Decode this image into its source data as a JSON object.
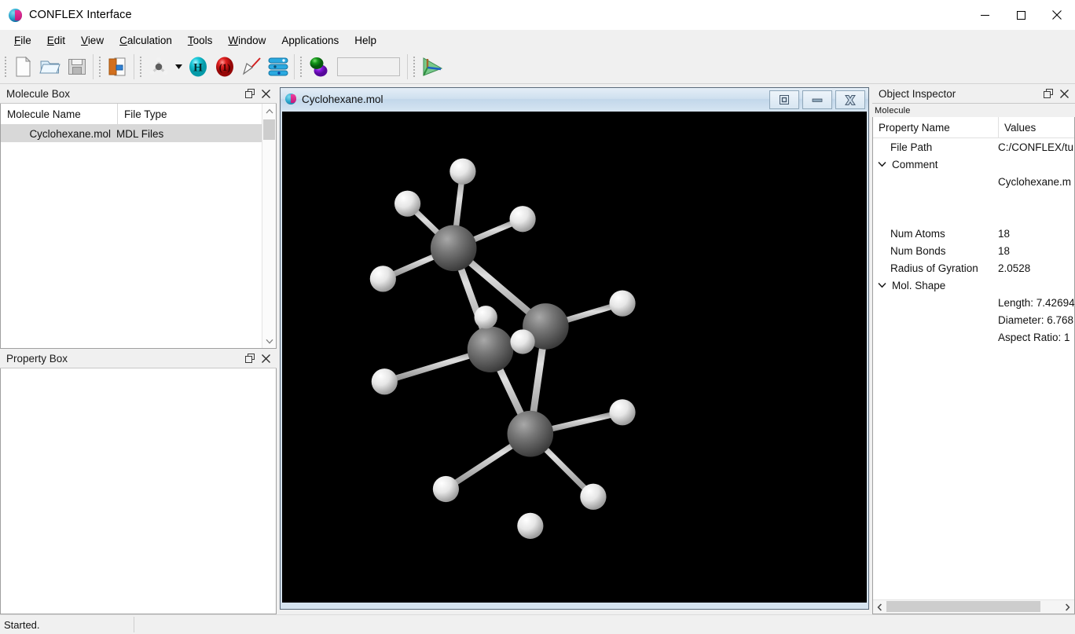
{
  "window": {
    "title": "CONFLEX Interface",
    "logo_icon": "conflex-logo-icon",
    "controls": [
      {
        "name": "minimize",
        "icon": "minimize-icon"
      },
      {
        "name": "maximize",
        "icon": "maximize-icon"
      },
      {
        "name": "close",
        "icon": "close-icon"
      }
    ]
  },
  "menubar": {
    "items": [
      {
        "label": "File",
        "mnemonic": "F"
      },
      {
        "label": "Edit",
        "mnemonic": "E"
      },
      {
        "label": "View",
        "mnemonic": "V"
      },
      {
        "label": "Calculation",
        "mnemonic": "C"
      },
      {
        "label": "Tools",
        "mnemonic": "T"
      },
      {
        "label": "Window",
        "mnemonic": "W"
      },
      {
        "label": "Applications",
        "mnemonic": ""
      },
      {
        "label": "Help",
        "mnemonic": ""
      }
    ]
  },
  "toolbar": {
    "buttons": [
      {
        "name": "new-file-button",
        "icon": "new-document-icon"
      },
      {
        "name": "open-file-button",
        "icon": "open-folder-icon"
      },
      {
        "name": "save-file-button",
        "icon": "floppy-save-icon"
      },
      {
        "name": "import-export-button",
        "icon": "import-document-icon"
      },
      {
        "name": "molecule-model-button",
        "icon": "molecule-model-icon"
      },
      {
        "name": "molecule-model-dropdown",
        "icon": "chevron-down-icon"
      },
      {
        "name": "add-hydrogen-button",
        "icon": "hydrogen-sphere-icon",
        "label": "H"
      },
      {
        "name": "formal-charge-button",
        "icon": "charge-sphere-icon",
        "label": "(1)"
      },
      {
        "name": "draw-tool-button",
        "icon": "pencil-wand-icon"
      },
      {
        "name": "layers-button",
        "icon": "stacked-layers-icon"
      },
      {
        "name": "optimize-button",
        "icon": "two-spheres-icon"
      },
      {
        "name": "axes-button",
        "icon": "green-axes-icon"
      }
    ],
    "field_value": "",
    "field_placeholder": ""
  },
  "molecule_box": {
    "title": "Molecule Box",
    "float_icon": "float-panel-icon",
    "close_icon": "close-icon",
    "columns": [
      "Molecule Name",
      "File Type"
    ],
    "rows": [
      {
        "name": "Cyclohexane.mol",
        "type": "MDL Files",
        "selected": true
      }
    ],
    "scroll_up_icon": "chevron-up-icon",
    "scroll_down_icon": "chevron-down-icon"
  },
  "property_box": {
    "title": "Property Box",
    "float_icon": "float-panel-icon",
    "close_icon": "close-icon",
    "content": ""
  },
  "mdi_window": {
    "title": "Cyclohexane.mol",
    "logo_icon": "conflex-logo-icon",
    "buttons": [
      {
        "name": "restore-button",
        "icon": "restore-icon"
      },
      {
        "name": "minimize-button",
        "icon": "minimize-icon"
      },
      {
        "name": "close-button",
        "icon": "close-x-icon"
      }
    ],
    "canvas_background": "#000000",
    "molecule": {
      "carbon_color": "#6e6e6e",
      "hydrogen_color": "#f2f2f2",
      "bond_color": "#c8c8c8"
    }
  },
  "object_inspector": {
    "title": "Object Inspector",
    "float_icon": "float-panel-icon",
    "close_icon": "close-icon",
    "subheader": "Molecule",
    "columns": [
      "Property Name",
      "Values"
    ],
    "rows": [
      {
        "name": "File Path",
        "value": "C:/CONFLEX/tu",
        "twisty": "",
        "indent": true
      },
      {
        "name": "Comment",
        "value": "",
        "twisty": "expanded",
        "indent": false
      },
      {
        "name": "",
        "value": "Cyclohexane.m",
        "twisty": "",
        "indent": true
      },
      {
        "name": "",
        "value": "",
        "twisty": "",
        "indent": true
      },
      {
        "name": "",
        "value": "",
        "twisty": "",
        "indent": true
      },
      {
        "name": "Num Atoms",
        "value": "18",
        "twisty": "",
        "indent": true
      },
      {
        "name": "Num Bonds",
        "value": "18",
        "twisty": "",
        "indent": true
      },
      {
        "name": "Radius of Gyration",
        "value": "2.0528",
        "twisty": "",
        "indent": true
      },
      {
        "name": "Mol. Shape",
        "value": "",
        "twisty": "expanded",
        "indent": false
      },
      {
        "name": "",
        "value": "Length: 7.42694",
        "twisty": "",
        "indent": true
      },
      {
        "name": "",
        "value": "Diameter: 6.768",
        "twisty": "",
        "indent": true
      },
      {
        "name": "",
        "value": "Aspect Ratio: 1",
        "twisty": "",
        "indent": true
      }
    ],
    "scroll_left_icon": "chevron-left-icon",
    "scroll_right_icon": "chevron-right-icon"
  },
  "statusbar": {
    "message": "Started."
  },
  "colors": {
    "window_bg": "#f0f0f0",
    "panel_bg": "#ffffff",
    "selection": "#d8d8d8",
    "mdi_titlebar": "#cfe0ef",
    "canvas": "#000000"
  }
}
